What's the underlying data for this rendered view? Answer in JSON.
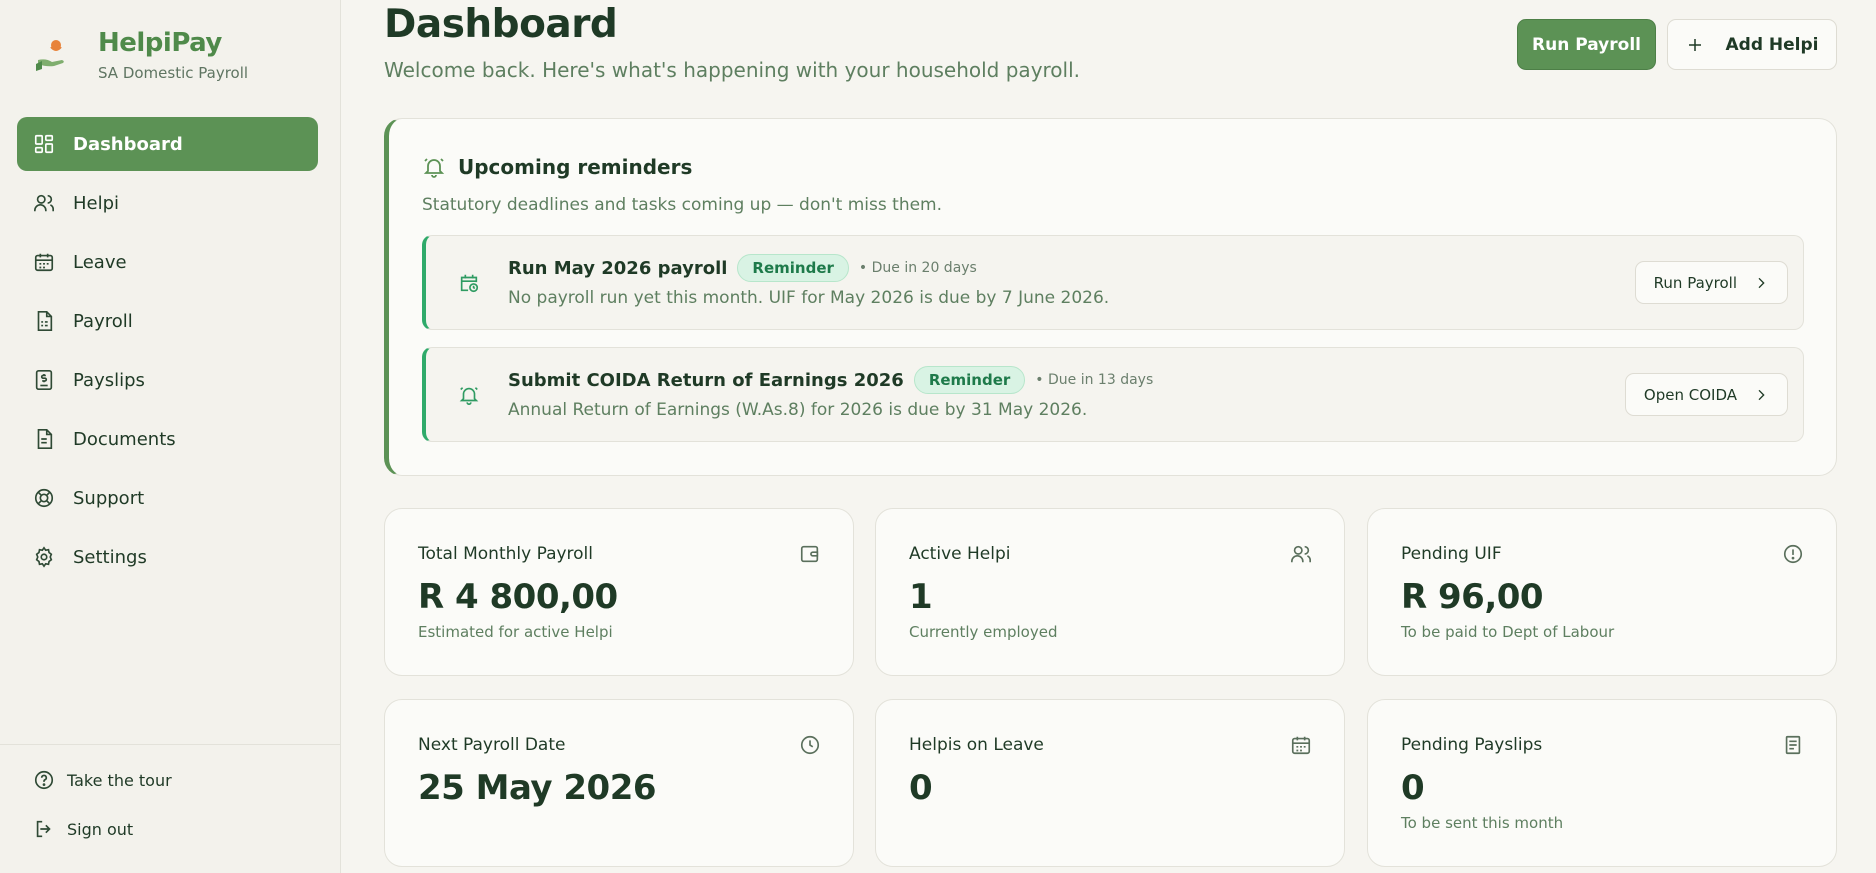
{
  "sidebar": {
    "brand_name": "HelpiPay",
    "brand_sub": "SA Domestic Payroll",
    "items": [
      {
        "label": "Dashboard",
        "icon": "dashboard-icon"
      },
      {
        "label": "Helpi",
        "icon": "users-icon"
      },
      {
        "label": "Leave",
        "icon": "calendar-icon"
      },
      {
        "label": "Payroll",
        "icon": "document-icon"
      },
      {
        "label": "Payslips",
        "icon": "payslip-icon"
      },
      {
        "label": "Documents",
        "icon": "file-icon"
      },
      {
        "label": "Support",
        "icon": "lifebuoy-icon"
      },
      {
        "label": "Settings",
        "icon": "gear-icon"
      }
    ],
    "footer": {
      "tour_label": "Take the tour",
      "signout_label": "Sign out"
    }
  },
  "header": {
    "title": "Dashboard",
    "subtitle": "Welcome back. Here's what's happening with your household payroll.",
    "run_payroll_label": "Run Payroll",
    "add_helpi_label": "Add Helpi"
  },
  "reminders": {
    "title": "Upcoming reminders",
    "subtitle": "Statutory deadlines and tasks coming up — don't miss them.",
    "items": [
      {
        "title": "Run May 2026 payroll",
        "badge": "Reminder",
        "due": "• Due in 20 days",
        "description": "No payroll run yet this month. UIF for May 2026 is due by 7 June 2026.",
        "action": "Run Payroll"
      },
      {
        "title": "Submit COIDA Return of Earnings 2026",
        "badge": "Reminder",
        "due": "• Due in 13 days",
        "description": "Annual Return of Earnings (W.As.8) for 2026 is due by 31 May 2026.",
        "action": "Open COIDA"
      }
    ]
  },
  "stats": [
    {
      "label": "Total Monthly Payroll",
      "value": "R 4 800,00",
      "sub": "Estimated for active Helpi",
      "icon": "wallet-icon"
    },
    {
      "label": "Active Helpi",
      "value": "1",
      "sub": "Currently employed",
      "icon": "users-icon"
    },
    {
      "label": "Pending UIF",
      "value": "R 96,00",
      "sub": "To be paid to Dept of Labour",
      "icon": "alert-circle-icon"
    },
    {
      "label": "Next Payroll Date",
      "value": "25 May 2026",
      "sub": "",
      "icon": "clock-icon"
    },
    {
      "label": "Helpis on Leave",
      "value": "0",
      "sub": "",
      "icon": "calendar-icon"
    },
    {
      "label": "Pending Payslips",
      "value": "0",
      "sub": "To be sent this month",
      "icon": "clipboard-icon"
    }
  ],
  "colors": {
    "accent": "#5c9255",
    "reminder_green": "#2faa6a",
    "background": "#f6f5f0",
    "text": "#1f3a26"
  }
}
